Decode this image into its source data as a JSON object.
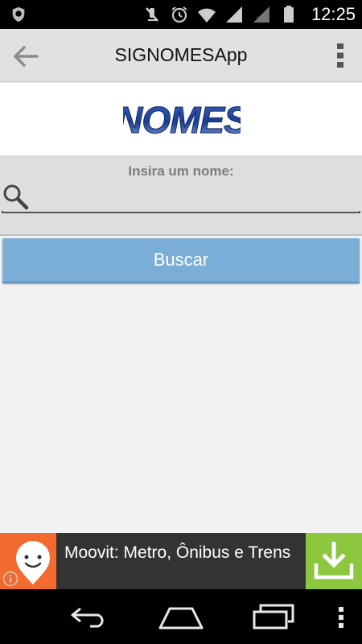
{
  "status_bar": {
    "time": "12:25",
    "icons": [
      "shield-icon",
      "mute-icon",
      "alarm-icon",
      "wifi-icon",
      "signal-icon",
      "signal-icon",
      "battery-icon"
    ]
  },
  "action_bar": {
    "title": "SIGNOMESApp",
    "icons": [
      "back-arrow-icon",
      "overflow-menu-icon"
    ]
  },
  "logo": {
    "text": "NOMES",
    "color": "#2a4a9a"
  },
  "search": {
    "label": "Insira um nome:",
    "value": "",
    "placeholder": "",
    "icon": "search-icon"
  },
  "button": {
    "label": "Buscar",
    "color": "#7aaed6"
  },
  "ad": {
    "text": "Moovit: Metro, Ônibus e Trens",
    "logo_color": "#f26a2e",
    "download_color": "#8dc63f",
    "icons": [
      "moovit-logo-icon",
      "info-icon",
      "download-icon"
    ]
  },
  "nav_bar": {
    "icons": [
      "nav-back-icon",
      "nav-home-icon",
      "nav-recent-apps-icon",
      "nav-menu-icon"
    ]
  }
}
